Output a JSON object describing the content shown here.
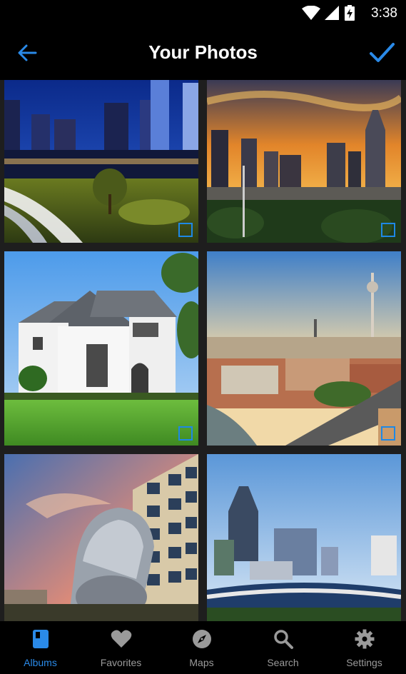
{
  "status_bar": {
    "time": "3:38"
  },
  "app_bar": {
    "title": "Your Photos"
  },
  "photos": [
    {
      "name": "Charlotte skyline at night"
    },
    {
      "name": "Charlotte skyline at sunset"
    },
    {
      "name": "White house with lawn"
    },
    {
      "name": "Berlin cityscape with TV tower"
    },
    {
      "name": "Metalmorphosis head sculpture"
    },
    {
      "name": "Skyline with stadium"
    }
  ],
  "tabs": [
    {
      "label": "Albums",
      "icon": "book-icon",
      "active": true
    },
    {
      "label": "Favorites",
      "icon": "heart-icon"
    },
    {
      "label": "Maps",
      "icon": "compass-icon"
    },
    {
      "label": "Search",
      "icon": "search-icon"
    },
    {
      "label": "Settings",
      "icon": "gear-icon"
    }
  ],
  "colors": {
    "accent": "#2a8ae8",
    "selection": "#1e88e5",
    "background": "#000000"
  }
}
